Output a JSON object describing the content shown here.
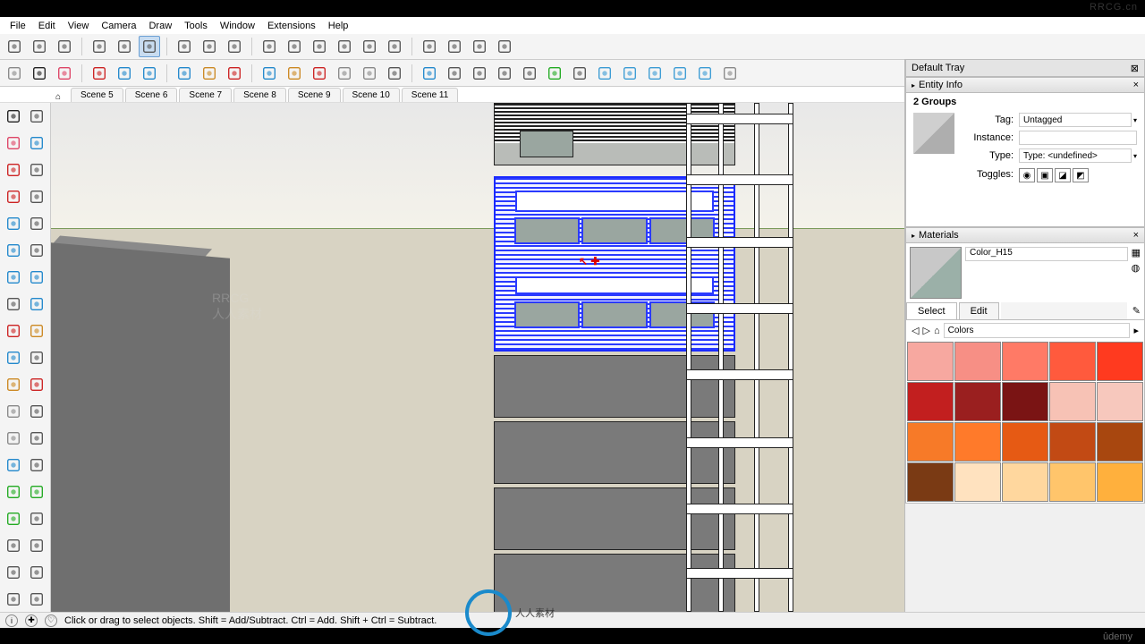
{
  "watermark_tr": "RRCG.cn",
  "udemy": "ûdemy",
  "logo_text": "人人素材",
  "menus": [
    "File",
    "Edit",
    "View",
    "Camera",
    "Draw",
    "Tools",
    "Window",
    "Extensions",
    "Help"
  ],
  "scene_tabs": [
    "Scene 5",
    "Scene 6",
    "Scene 7",
    "Scene 8",
    "Scene 9",
    "Scene 10",
    "Scene 11"
  ],
  "tray": {
    "title": "Default Tray",
    "entity": {
      "header": "Entity Info",
      "groups_label": "2 Groups",
      "tag_label": "Tag:",
      "tag_value": "Untagged",
      "instance_label": "Instance:",
      "instance_value": "",
      "type_label": "Type:",
      "type_value": "Type: <undefined>",
      "toggles_label": "Toggles:"
    },
    "materials": {
      "header": "Materials",
      "name": "Color_H15",
      "tab_select": "Select",
      "tab_edit": "Edit",
      "library": "Colors",
      "swatches": [
        "#f7a8a0",
        "#f78f85",
        "#ff7a66",
        "#ff5a3d",
        "#ff3a1f",
        "#c21f1f",
        "#9a1f1f",
        "#7a1414",
        "#f7c2b5",
        "#f7c8bd",
        "#f77a28",
        "#ff7a2a",
        "#e65a14",
        "#c24a14",
        "#a8470f",
        "#7a3a14",
        "#ffe2bf",
        "#ffd79e",
        "#ffc56b",
        "#ffb03d"
      ]
    }
  },
  "status": {
    "hint": "Click or drag to select objects. Shift = Add/Subtract. Ctrl = Add. Shift + Ctrl = Subtract."
  },
  "top_toolbar1_icons": [
    "new-icon",
    "open-icon",
    "save-icon",
    "cut-icon",
    "copy-icon",
    "paste-icon",
    "undo-icon",
    "redo-icon",
    "print-icon",
    "model-icon",
    "layers-icon",
    "outliner-icon",
    "shadows-icon",
    "fog-icon",
    "xray-icon",
    "wire-icon",
    "hidden-icon",
    "mono-icon",
    "tex-icon"
  ],
  "top_toolbar2_icons": [
    "search-icon",
    "select-icon",
    "eraser-icon",
    "line-icon",
    "rect-icon",
    "circle-icon",
    "arc-icon",
    "pushpull-icon",
    "move-icon",
    "rotate-icon",
    "scale-icon",
    "offset-icon",
    "tape-icon",
    "protractor-icon",
    "text-icon",
    "axes-icon",
    "dim-icon",
    "section-icon",
    "walk-icon",
    "look-icon",
    "zoom-icon",
    "zoomext-icon",
    "cloud-icon",
    "cloud2-icon",
    "cloud3-icon",
    "cloud4-icon",
    "cloud5-icon",
    "user-icon"
  ],
  "left_icons": [
    "select-icon",
    "lasso-icon",
    "eraser-icon",
    "paint-icon",
    "pencil-icon",
    "freehand-icon",
    "line-icon",
    "wave-icon",
    "rect-icon",
    "rotrect-icon",
    "circle-icon",
    "poly-icon",
    "arc-icon",
    "arc2-icon",
    "pie-icon",
    "arc3-icon",
    "move-icon",
    "pushpull-icon",
    "rotate-icon",
    "followme-icon",
    "scale-icon",
    "offset-icon",
    "tape-icon",
    "dim-icon",
    "protractor-icon",
    "text-icon",
    "axes-icon",
    "3dtext-icon",
    "orbit-icon",
    "pan-icon",
    "zoom-icon",
    "zoomwin-icon",
    "prev-icon",
    "zoomext-icon",
    "pos-icon",
    "look-icon",
    "walk-icon",
    "section2-icon"
  ]
}
